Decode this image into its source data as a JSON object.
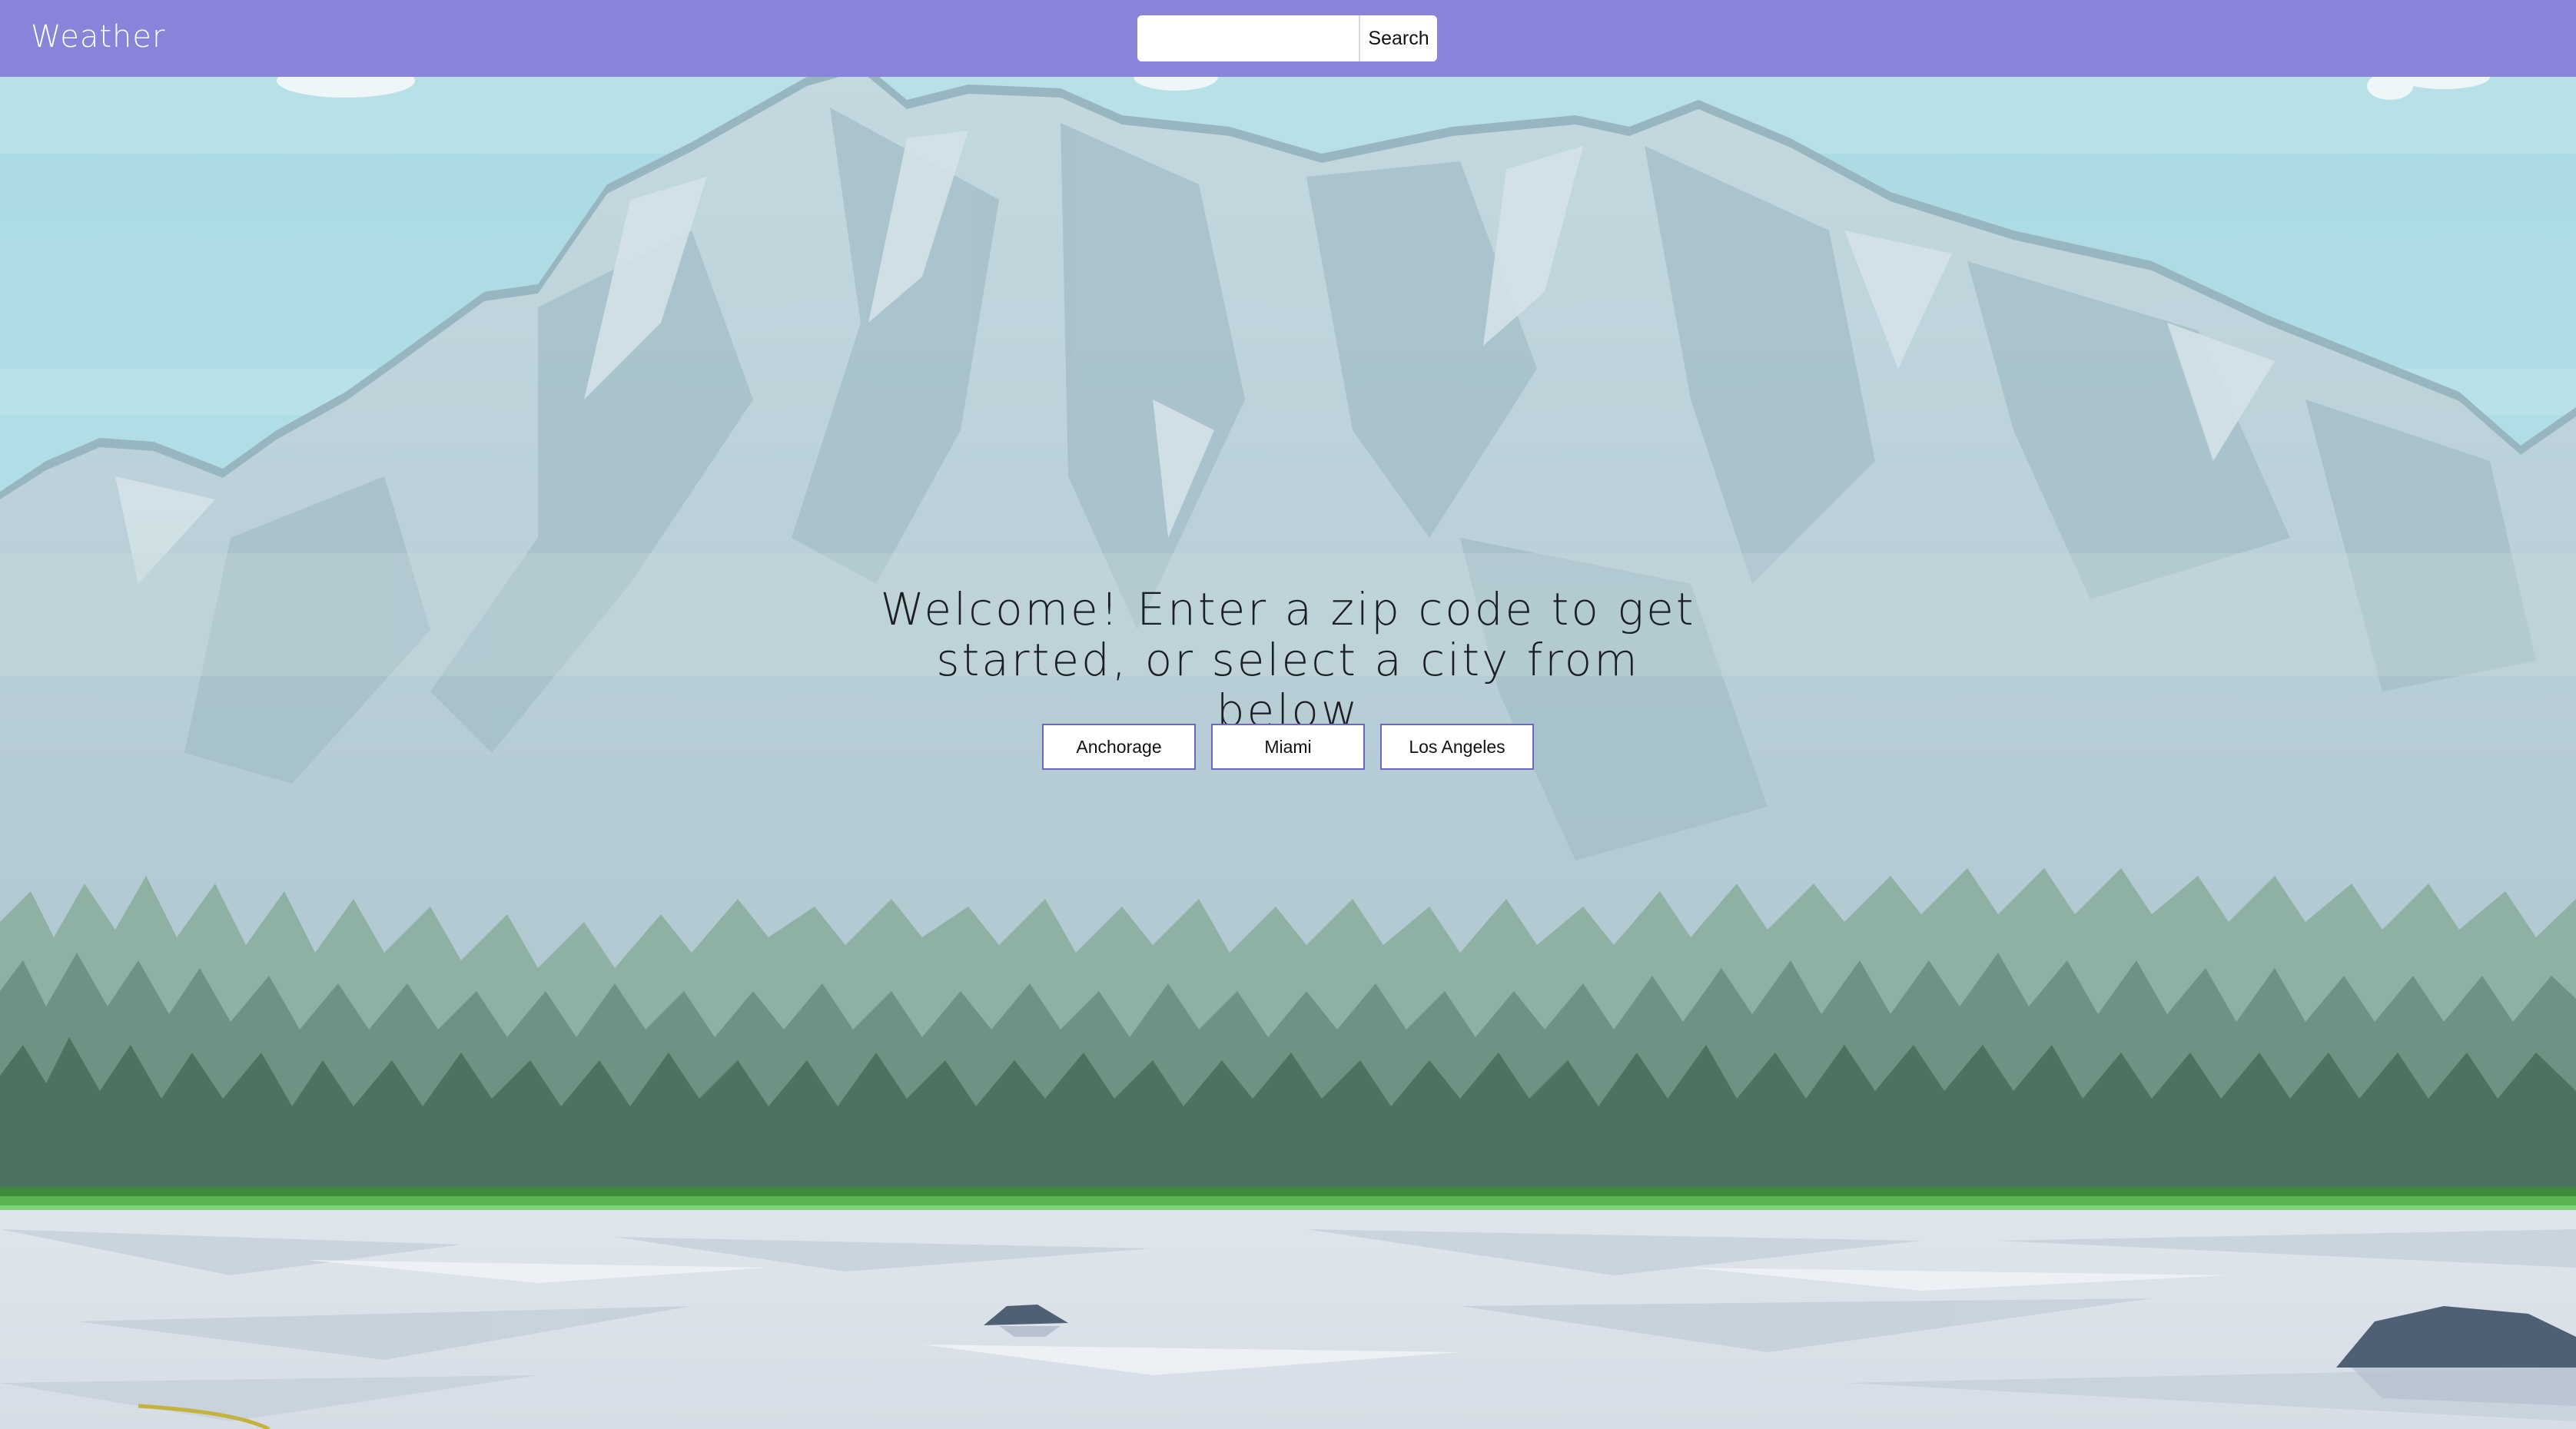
{
  "header": {
    "app_title": "Weather",
    "search": {
      "value": "",
      "placeholder": "",
      "button_label": "Search"
    }
  },
  "main": {
    "welcome_text": "Welcome! Enter a zip code to get started, or select a city from below",
    "cities": [
      {
        "label": "Anchorage"
      },
      {
        "label": "Miami"
      },
      {
        "label": "Los Angeles"
      }
    ]
  },
  "background": {
    "scene": "mountain-forest-landscape",
    "colors": {
      "header": "#8784da",
      "sky": "#a9dde6",
      "mountain": "#b9cfd8",
      "snow": "#d6e4ea",
      "forest_dark": "#4f7363",
      "forest_light": "#86a89a",
      "grass": "#4fa64a",
      "ice": "#dde3ea",
      "city_button_border": "#6a67c9"
    }
  }
}
